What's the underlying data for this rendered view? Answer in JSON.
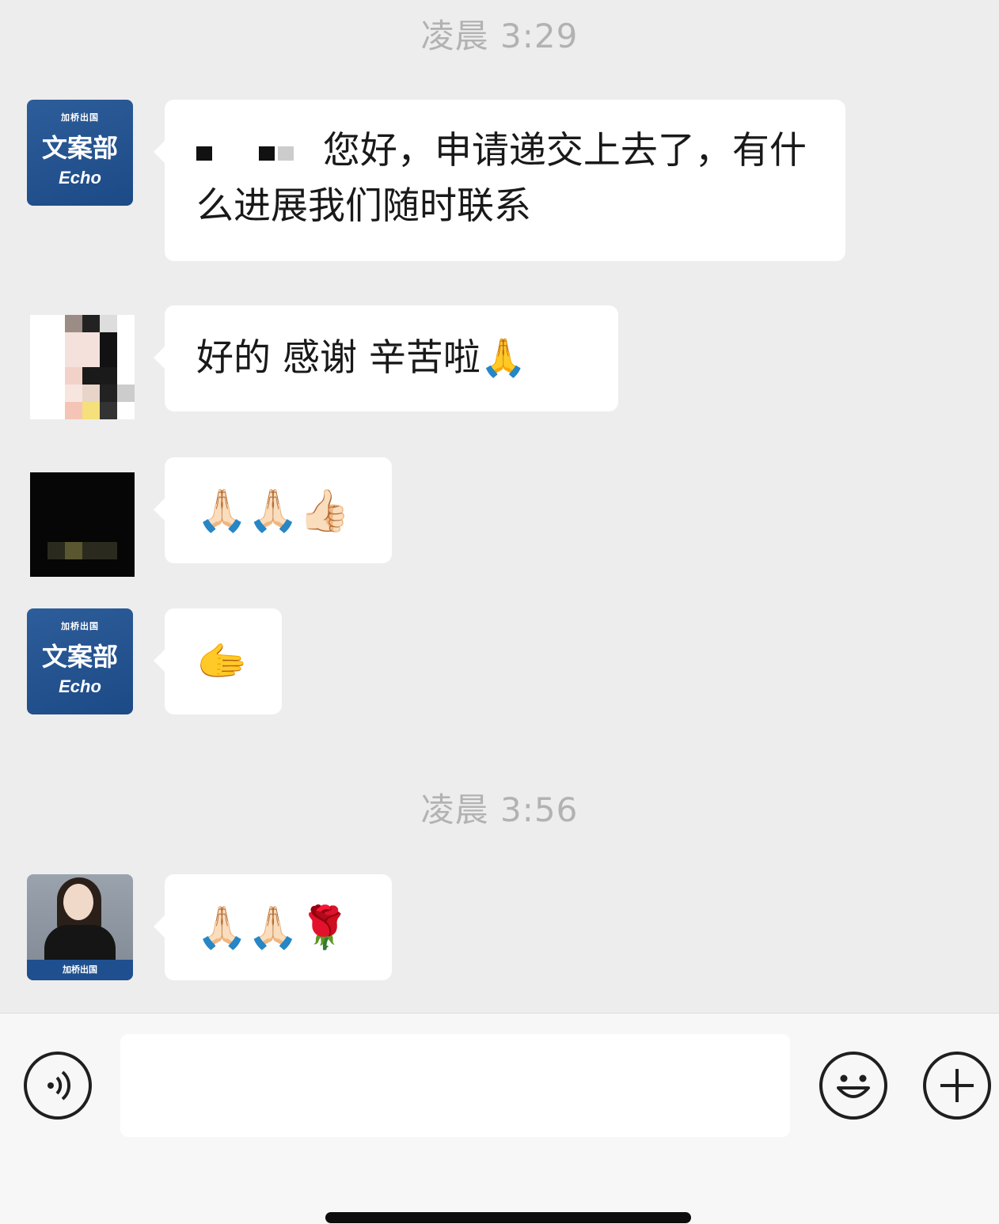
{
  "timestamps": [
    "凌晨 3:29",
    "凌晨 3:56"
  ],
  "avatars": {
    "brand_logo": "加桥出国",
    "brand_dept": "文案部",
    "brand_name": "Echo"
  },
  "messages": [
    {
      "sender": "agent-echo",
      "text": "您好，申请递交上去了，有什么进展我们随时联系"
    },
    {
      "sender": "user-pixelated",
      "text": "好的 感谢 辛苦啦🙏"
    },
    {
      "sender": "user-dark",
      "text": "🙏🏻🙏🏻👍🏻"
    },
    {
      "sender": "agent-echo",
      "text": "🫱"
    },
    {
      "sender": "agent-photo",
      "text": "🙏🏻🙏🏻🌹"
    }
  ],
  "input": {
    "placeholder": ""
  },
  "icons": {
    "voice": "voice-icon",
    "emoji": "smiley-icon",
    "plus": "plus-icon"
  }
}
